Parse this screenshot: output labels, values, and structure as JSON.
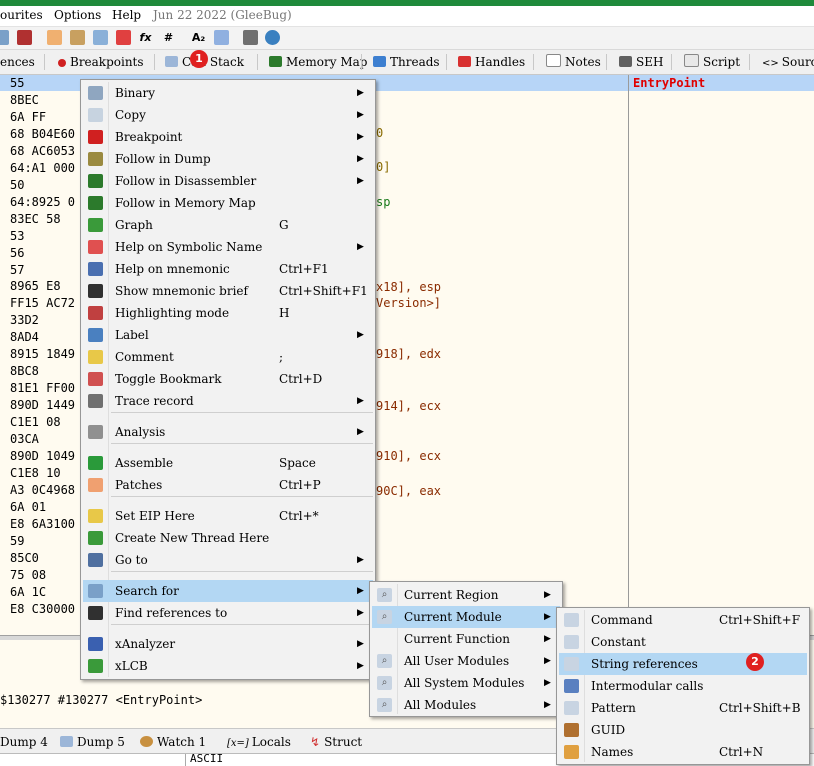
{
  "menubar": {
    "items": [
      "ourites",
      "Options",
      "Help"
    ],
    "date": "Jun 22 2022 (GleeBug)"
  },
  "toolbar": {
    "icons": [
      "script-icon",
      "bug-icon",
      "pen-icon",
      "link-icon",
      "tag-icon",
      "eraser-icon",
      "function-icon",
      "hash-icon",
      "font-icon",
      "document-icon",
      "calculator-icon",
      "globe-icon"
    ],
    "fx": "fx",
    "hash": "#",
    "font": "A₂"
  },
  "tabs": [
    {
      "label": "ences"
    },
    {
      "label": "Breakpoints"
    },
    {
      "label": "Call Stack"
    },
    {
      "label": "Memory Map"
    },
    {
      "label": "Threads"
    },
    {
      "label": "Handles"
    },
    {
      "label": "Notes"
    },
    {
      "label": "SEH"
    },
    {
      "label": "Script"
    },
    {
      "label": "Source"
    }
  ],
  "disasm": {
    "lines": [
      "55",
      "8BEC",
      "6A FF",
      "68 B04E60",
      "68 AC6053",
      "64:A1 000",
      "50",
      "64:8925 0",
      "83EC 58",
      "53",
      "56",
      "57",
      "8965 E8",
      "FF15 AC72",
      "33D2",
      "8AD4",
      "8915 1849",
      "8BC8",
      "81E1 FF00",
      "890D 1449",
      "C1E1 08",
      "03CA",
      "890D 1049",
      "C1E8 10",
      "A3 0C4968",
      "6A 01",
      "E8 6A3100",
      "59",
      "85C0",
      "75 08",
      "6A 1C",
      "E8 C30000"
    ],
    "fragments": [
      "0",
      "0]",
      "sp",
      "x18], esp",
      "Version>]",
      "918], edx",
      "914], ecx",
      "910], ecx",
      "90C], eax"
    ]
  },
  "right_pane": {
    "label": "EntryPoint"
  },
  "info": {
    "text": "$130277 #130277 <EntryPoint>"
  },
  "bottom_tabs": [
    {
      "label": "Dump 4"
    },
    {
      "label": "Dump 5"
    },
    {
      "label": "Watch 1"
    },
    {
      "label": "Locals"
    },
    {
      "label": "Struct"
    }
  ],
  "bottom_tab_locals_icon": "[x=]",
  "dump_header": {
    "ascii": "ASCII"
  },
  "context_menu": {
    "items": [
      {
        "label": "Binary",
        "shortcut": "",
        "submenu": true
      },
      {
        "label": "Copy",
        "shortcut": "",
        "submenu": true
      },
      {
        "label": "Breakpoint",
        "shortcut": "",
        "submenu": true
      },
      {
        "label": "Follow in Dump",
        "shortcut": "",
        "submenu": true
      },
      {
        "label": "Follow in Disassembler",
        "shortcut": "",
        "submenu": true
      },
      {
        "label": "Follow in Memory Map",
        "shortcut": "",
        "submenu": false
      },
      {
        "label": "Graph",
        "shortcut": "G",
        "submenu": false
      },
      {
        "label": "Help on Symbolic Name",
        "shortcut": "",
        "submenu": true
      },
      {
        "label": "Help on mnemonic",
        "shortcut": "Ctrl+F1",
        "submenu": false
      },
      {
        "label": "Show mnemonic brief",
        "shortcut": "Ctrl+Shift+F1",
        "submenu": false
      },
      {
        "label": "Highlighting mode",
        "shortcut": "H",
        "submenu": false
      },
      {
        "label": "Label",
        "shortcut": "",
        "submenu": true
      },
      {
        "label": "Comment",
        "shortcut": ";",
        "submenu": false
      },
      {
        "label": "Toggle Bookmark",
        "shortcut": "Ctrl+D",
        "submenu": false
      },
      {
        "label": "Trace record",
        "shortcut": "",
        "submenu": true
      },
      {
        "label": "Analysis",
        "shortcut": "",
        "submenu": true
      },
      {
        "label": "Assemble",
        "shortcut": "Space",
        "submenu": false
      },
      {
        "label": "Patches",
        "shortcut": "Ctrl+P",
        "submenu": false
      },
      {
        "label": "Set EIP Here",
        "shortcut": "Ctrl+*",
        "submenu": false
      },
      {
        "label": "Create New Thread Here",
        "shortcut": "",
        "submenu": false
      },
      {
        "label": "Go to",
        "shortcut": "",
        "submenu": true
      },
      {
        "label": "Search for",
        "shortcut": "",
        "submenu": true,
        "highlighted": true
      },
      {
        "label": "Find references to",
        "shortcut": "",
        "submenu": true
      },
      {
        "label": "xAnalyzer",
        "shortcut": "",
        "submenu": true
      },
      {
        "label": "xLCB",
        "shortcut": "",
        "submenu": true
      }
    ]
  },
  "search_submenu": {
    "items": [
      {
        "label": "Current Region",
        "submenu": true
      },
      {
        "label": "Current Module",
        "submenu": true,
        "highlighted": true
      },
      {
        "label": "Current Function",
        "submenu": true
      },
      {
        "label": "All User Modules",
        "submenu": true
      },
      {
        "label": "All System Modules",
        "submenu": true
      },
      {
        "label": "All Modules",
        "submenu": true
      }
    ]
  },
  "module_submenu": {
    "items": [
      {
        "label": "Command",
        "shortcut": "Ctrl+Shift+F"
      },
      {
        "label": "Constant",
        "shortcut": ""
      },
      {
        "label": "String references",
        "shortcut": "",
        "highlighted": true
      },
      {
        "label": "Intermodular calls",
        "shortcut": ""
      },
      {
        "label": "Pattern",
        "shortcut": "Ctrl+Shift+B"
      },
      {
        "label": "GUID",
        "shortcut": ""
      },
      {
        "label": "Names",
        "shortcut": "Ctrl+N"
      }
    ]
  },
  "badges": {
    "one": "1",
    "two": "2"
  },
  "colors": {
    "highlight": "#b3d7f3",
    "badge": "#e02020",
    "entry": "#e00000",
    "titlebar": "#1f8a3b"
  }
}
